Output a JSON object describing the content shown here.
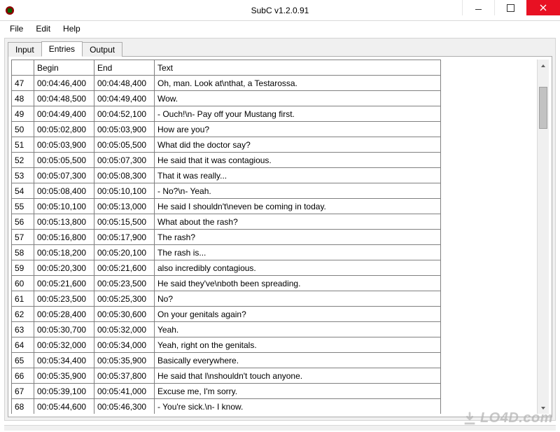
{
  "window": {
    "title": "SubC v1.2.0.91"
  },
  "menu": {
    "file": "File",
    "edit": "Edit",
    "help": "Help"
  },
  "tabs": {
    "input": "Input",
    "entries": "Entries",
    "output": "Output"
  },
  "table": {
    "headers": {
      "index": "",
      "begin": "Begin",
      "end": "End",
      "text": "Text"
    },
    "rows": [
      {
        "n": "47",
        "begin": "00:04:46,400",
        "end": "00:04:48,400",
        "text": "Oh, man. Look at\\nthat, a Testarossa."
      },
      {
        "n": "48",
        "begin": "00:04:48,500",
        "end": "00:04:49,400",
        "text": "Wow."
      },
      {
        "n": "49",
        "begin": "00:04:49,400",
        "end": "00:04:52,100",
        "text": "- Ouch!\\n- Pay off your Mustang first."
      },
      {
        "n": "50",
        "begin": "00:05:02,800",
        "end": "00:05:03,900",
        "text": "How are you?"
      },
      {
        "n": "51",
        "begin": "00:05:03,900",
        "end": "00:05:05,500",
        "text": "What did the doctor say?"
      },
      {
        "n": "52",
        "begin": "00:05:05,500",
        "end": "00:05:07,300",
        "text": "He said that it was contagious."
      },
      {
        "n": "53",
        "begin": "00:05:07,300",
        "end": "00:05:08,300",
        "text": "That it was really..."
      },
      {
        "n": "54",
        "begin": "00:05:08,400",
        "end": "00:05:10,100",
        "text": "- No?\\n- Yeah."
      },
      {
        "n": "55",
        "begin": "00:05:10,100",
        "end": "00:05:13,000",
        "text": "He said I shouldn't\\neven be coming in today."
      },
      {
        "n": "56",
        "begin": "00:05:13,800",
        "end": "00:05:15,500",
        "text": "What about the rash?"
      },
      {
        "n": "57",
        "begin": "00:05:16,800",
        "end": "00:05:17,900",
        "text": "The rash?"
      },
      {
        "n": "58",
        "begin": "00:05:18,200",
        "end": "00:05:20,100",
        "text": "The rash is..."
      },
      {
        "n": "59",
        "begin": "00:05:20,300",
        "end": "00:05:21,600",
        "text": "also incredibly contagious."
      },
      {
        "n": "60",
        "begin": "00:05:21,600",
        "end": "00:05:23,500",
        "text": "He said they've\\nboth been spreading."
      },
      {
        "n": "61",
        "begin": "00:05:23,500",
        "end": "00:05:25,300",
        "text": "No?"
      },
      {
        "n": "62",
        "begin": "00:05:28,400",
        "end": "00:05:30,600",
        "text": "On your genitals again?"
      },
      {
        "n": "63",
        "begin": "00:05:30,700",
        "end": "00:05:32,000",
        "text": "Yeah."
      },
      {
        "n": "64",
        "begin": "00:05:32,000",
        "end": "00:05:34,000",
        "text": "Yeah, right on the genitals."
      },
      {
        "n": "65",
        "begin": "00:05:34,400",
        "end": "00:05:35,900",
        "text": "Basically everywhere."
      },
      {
        "n": "66",
        "begin": "00:05:35,900",
        "end": "00:05:37,800",
        "text": "He said that I\\nshouldn't touch anyone."
      },
      {
        "n": "67",
        "begin": "00:05:39,100",
        "end": "00:05:41,000",
        "text": "Excuse me, I'm sorry."
      },
      {
        "n": "68",
        "begin": "00:05:44,600",
        "end": "00:05:46,300",
        "text": "- You're sick.\\n- I know."
      }
    ]
  },
  "watermark": "LO4D.com"
}
